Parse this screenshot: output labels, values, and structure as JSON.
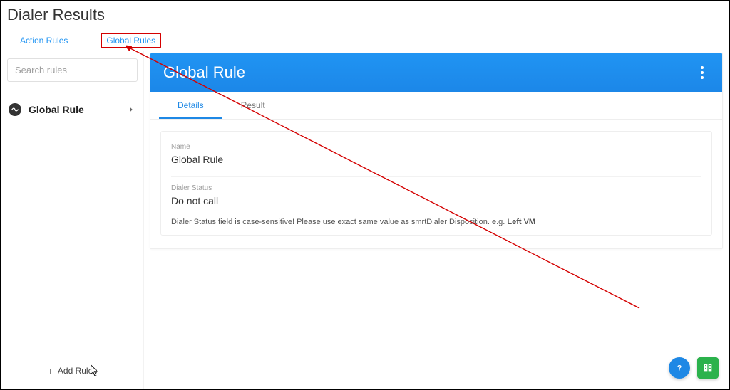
{
  "page": {
    "title": "Dialer Results"
  },
  "tabs": {
    "action_rules": "Action Rules",
    "global_rules": "Global Rules"
  },
  "sidebar": {
    "search_placeholder": "Search rules",
    "rule_item_label": "Global Rule",
    "add_rules_label": "Add Rules"
  },
  "panel": {
    "title": "Global Rule",
    "subtabs": {
      "details": "Details",
      "result": "Result"
    },
    "fields": {
      "name_label": "Name",
      "name_value": "Global Rule",
      "status_label": "Dialer Status",
      "status_value": "Do not call"
    },
    "hint_prefix": "Dialer Status field is case-sensitive! Please use exact same value as smrtDialer Disposition. e.g. ",
    "hint_bold": "Left VM"
  },
  "fab": {
    "help_title": "Help",
    "docs_title": "Docs"
  }
}
